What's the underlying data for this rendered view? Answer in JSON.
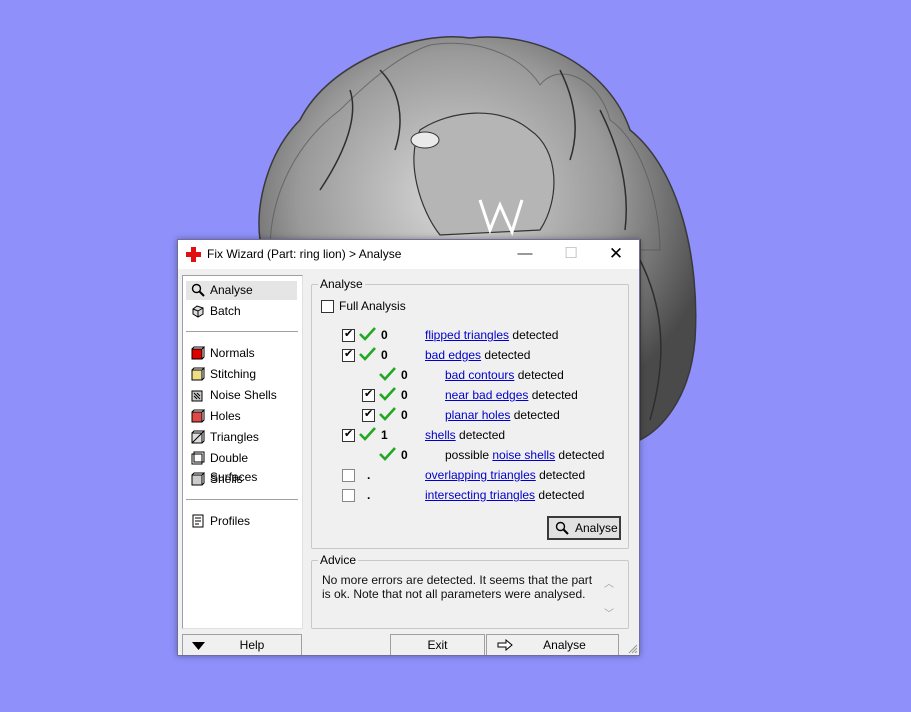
{
  "window": {
    "title": "Fix Wizard (Part: ring lion) > Analyse",
    "minimize": "—",
    "maximize": "☐",
    "close": "✕"
  },
  "nav": {
    "items": [
      {
        "label": "Analyse",
        "icon": "magnifier-icon",
        "selected": true
      },
      {
        "label": "Batch",
        "icon": "batch-icon"
      },
      {
        "label": "Normals",
        "icon": "normals-cube-icon",
        "color": "#e00000"
      },
      {
        "label": "Stitching",
        "icon": "stitching-cube-icon",
        "color": "#e8d67a"
      },
      {
        "label": "Noise Shells",
        "icon": "noise-shells-icon"
      },
      {
        "label": "Holes",
        "icon": "holes-cube-icon",
        "color": "#e05050"
      },
      {
        "label": "Triangles",
        "icon": "triangles-cube-icon"
      },
      {
        "label": "Double Surfaces",
        "icon": "double-surfaces-icon"
      },
      {
        "label": "Shells",
        "icon": "shells-cube-icon"
      },
      {
        "label": "Profiles",
        "icon": "profiles-icon"
      }
    ]
  },
  "analyse": {
    "group_label": "Analyse",
    "full_analysis_label": "Full Analysis",
    "rows": [
      {
        "checked": true,
        "count": "0",
        "link": "flipped triangles",
        "suffix": " detected"
      },
      {
        "checked": true,
        "count": "0",
        "link": "bad edges",
        "suffix": " detected"
      },
      {
        "count": "0",
        "link": "bad contours",
        "suffix": " detected"
      },
      {
        "checked": true,
        "count": "0",
        "link": "near bad edges",
        "suffix": " detected"
      },
      {
        "checked": true,
        "count": "0",
        "link": "planar holes",
        "suffix": " detected"
      },
      {
        "checked": true,
        "count": "1",
        "link": "shells",
        "suffix": " detected"
      },
      {
        "count": "0",
        "prefix": "possible ",
        "link": "noise shells",
        "suffix": " detected"
      },
      {
        "checked": false,
        "count": ".",
        "link": "overlapping triangles",
        "suffix": " detected"
      },
      {
        "checked": false,
        "count": ".",
        "link": "intersecting triangles",
        "suffix": " detected"
      }
    ],
    "analyse_button": "Analyse"
  },
  "advice": {
    "label": "Advice",
    "text": "No more errors are detected. It seems that the part is ok. Note that not all parameters were analysed."
  },
  "footer": {
    "help": "Help",
    "exit": "Exit",
    "analyse": "Analyse"
  },
  "colors": {
    "background": "#8f90fa",
    "check_green": "#22a822",
    "link": "#0000cc"
  }
}
